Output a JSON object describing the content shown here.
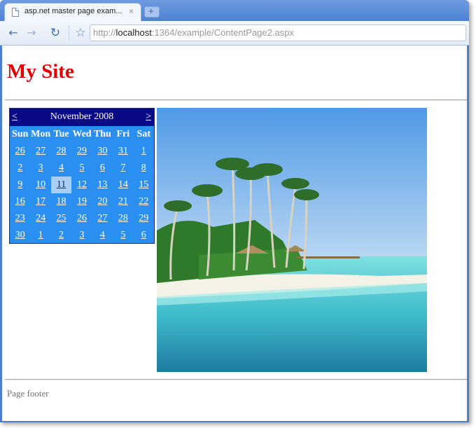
{
  "browser": {
    "tab_title": "asp.net master page exam...",
    "tab_close": "×",
    "new_tab": "+",
    "url_scheme": "http://",
    "url_host": "localhost",
    "url_rest": ":1364/example/ContentPage2.aspx"
  },
  "page": {
    "site_title": "My Site",
    "footer": "Page footer"
  },
  "calendar": {
    "prev": "<",
    "next": ">",
    "month": "November 2008",
    "days": [
      "Sun",
      "Mon",
      "Tue",
      "Wed",
      "Thu",
      "Fri",
      "Sat"
    ],
    "weeks": [
      [
        "26",
        "27",
        "28",
        "29",
        "30",
        "31",
        "1"
      ],
      [
        "2",
        "3",
        "4",
        "5",
        "6",
        "7",
        "8"
      ],
      [
        "9",
        "10",
        "11",
        "12",
        "13",
        "14",
        "15"
      ],
      [
        "16",
        "17",
        "18",
        "19",
        "20",
        "21",
        "22"
      ],
      [
        "23",
        "24",
        "25",
        "26",
        "27",
        "28",
        "29"
      ],
      [
        "30",
        "1",
        "2",
        "3",
        "4",
        "5",
        "6"
      ]
    ],
    "selected": "11"
  },
  "colors": {
    "site_title": "#e60000",
    "calendar_header": "#0a0a86",
    "calendar_body": "#2a8ff0",
    "calendar_selected": "#a9cff2"
  }
}
